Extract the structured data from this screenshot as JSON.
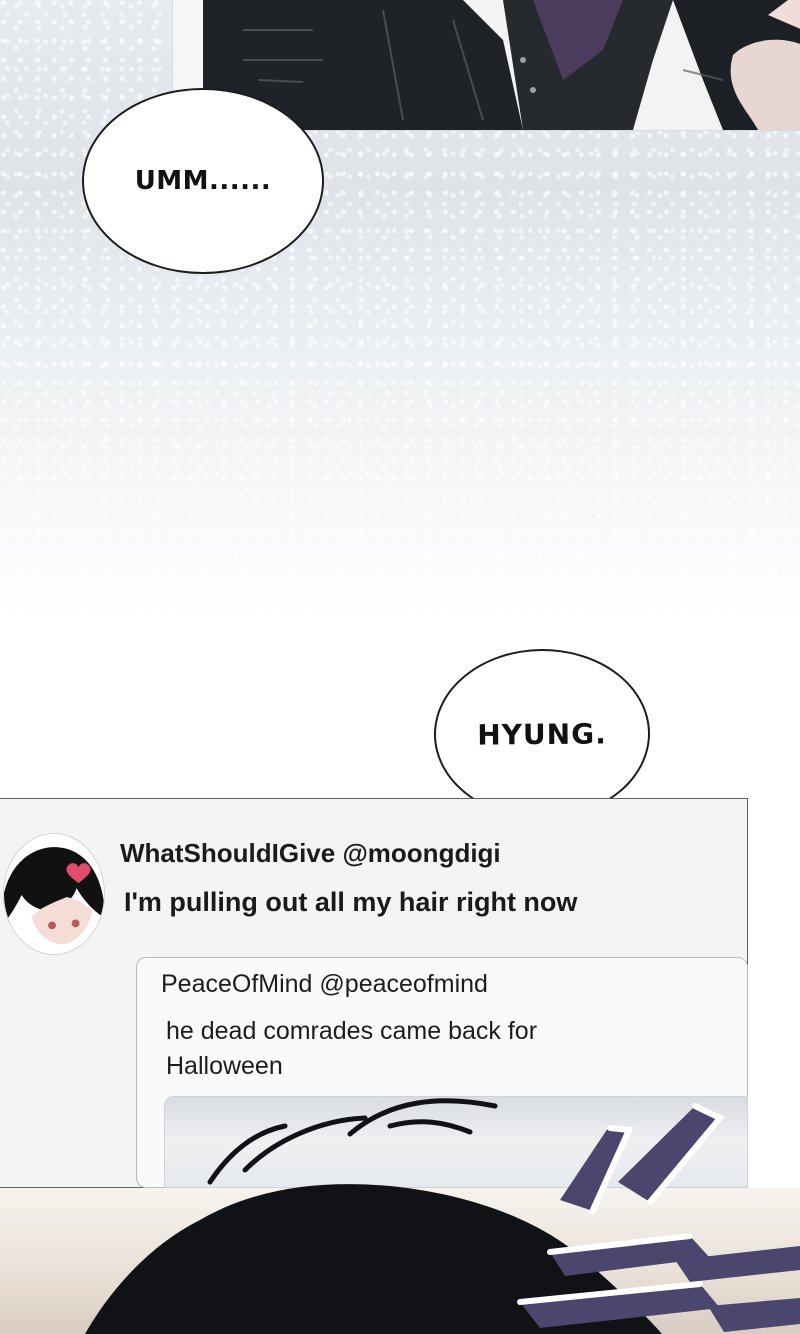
{
  "bubbles": {
    "first": "UMM......",
    "second": "HYUNG."
  },
  "post": {
    "handle": "WhatShouldIGive @moongdigi",
    "text": "I'm pulling out all my hair right now",
    "quoted": {
      "handle": "PeaceOfMind @peaceofmind",
      "text": "he dead comrades came back for Halloween"
    }
  }
}
